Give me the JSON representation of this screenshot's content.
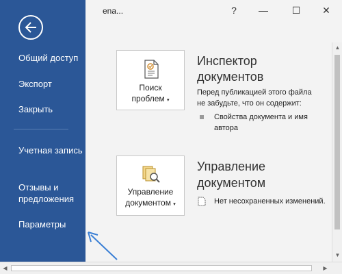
{
  "window": {
    "title": "ena...",
    "help": "?",
    "minimize": "—",
    "maximize": "☐",
    "close": "✕"
  },
  "sidebar": {
    "items": [
      {
        "label": "Общий доступ"
      },
      {
        "label": "Экспорт"
      },
      {
        "label": "Закрыть"
      },
      {
        "label": "Учетная запись"
      },
      {
        "label": "Отзывы и предложения"
      },
      {
        "label": "Параметры"
      }
    ]
  },
  "inspect": {
    "button_line1": "Поиск",
    "button_line2": "проблем",
    "title_line1": "Инспектор",
    "title_line2": "документов",
    "desc": "Перед публикацией этого файла не забудьте, что он содержит:",
    "bullet": "Свойства документа и имя автора"
  },
  "manage": {
    "button_line1": "Управление",
    "button_line2": "документом",
    "title_line1": "Управление",
    "title_line2": "документом",
    "bullet": "Нет несохраненных изменений."
  },
  "colors": {
    "sidebar": "#2b5797",
    "accent_arrow": "#3a7fd5"
  }
}
